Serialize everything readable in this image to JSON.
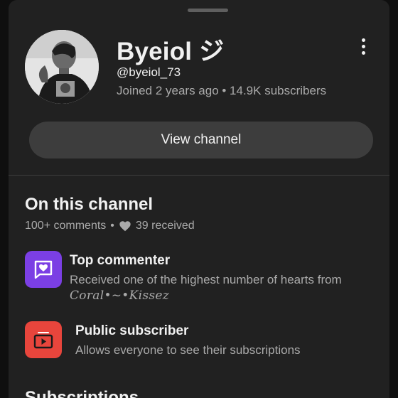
{
  "channel": {
    "name": "Byeiol ジ",
    "handle": "@byeiol_73",
    "meta": "Joined 2 years ago • 14.9K subscribers"
  },
  "actions": {
    "view_channel_label": "View channel",
    "more_icon": "more-vert-icon"
  },
  "on_this_channel": {
    "title": "On this channel",
    "comments": "100+ comments",
    "separator": "•",
    "hearts_received": "39 received",
    "heart_icon": "heart-icon"
  },
  "badges": [
    {
      "title": "Top commenter",
      "description": "Received one of the highest number of hearts from",
      "creator": "Coral•~•Kissez",
      "icon": "heart-comment-icon",
      "color": "#7b3fe4"
    },
    {
      "title": "Public subscriber",
      "description": "Allows everyone to see their subscriptions",
      "icon": "subscriptions-icon",
      "color": "#e8453c"
    }
  ],
  "next_section": {
    "title": "Subscriptions"
  },
  "colors": {
    "sheet_background": "#212121",
    "button_background": "#3d3d3d",
    "secondary_text": "#aaaaaa"
  }
}
